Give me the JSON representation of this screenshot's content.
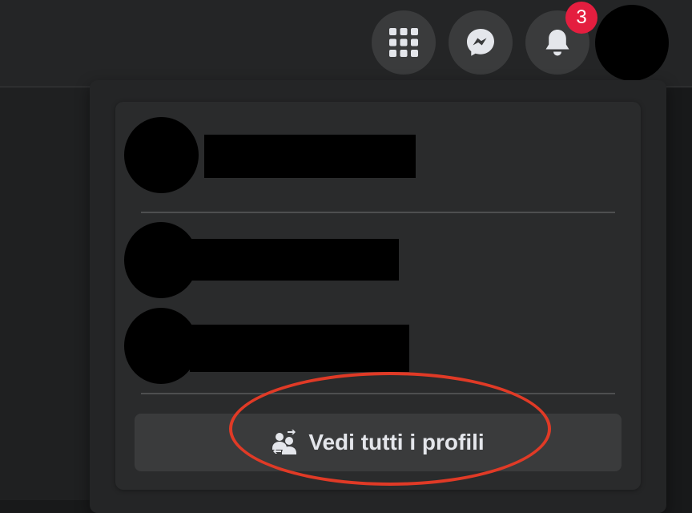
{
  "header": {
    "notifications_badge": "3",
    "icons": [
      "menu-grid-icon",
      "messenger-icon",
      "bell-icon"
    ]
  },
  "profiles_menu": {
    "see_all_label": "Vedi tutti i profili",
    "see_all_icon": "switch-profiles-icon"
  },
  "colors": {
    "page_bg": "#18191a",
    "topbar_bg": "#242526",
    "button_bg": "#3a3b3c",
    "badge": "#e41e3f",
    "annotation_ellipse": "#e03a26",
    "text": "#e4e6eb"
  }
}
